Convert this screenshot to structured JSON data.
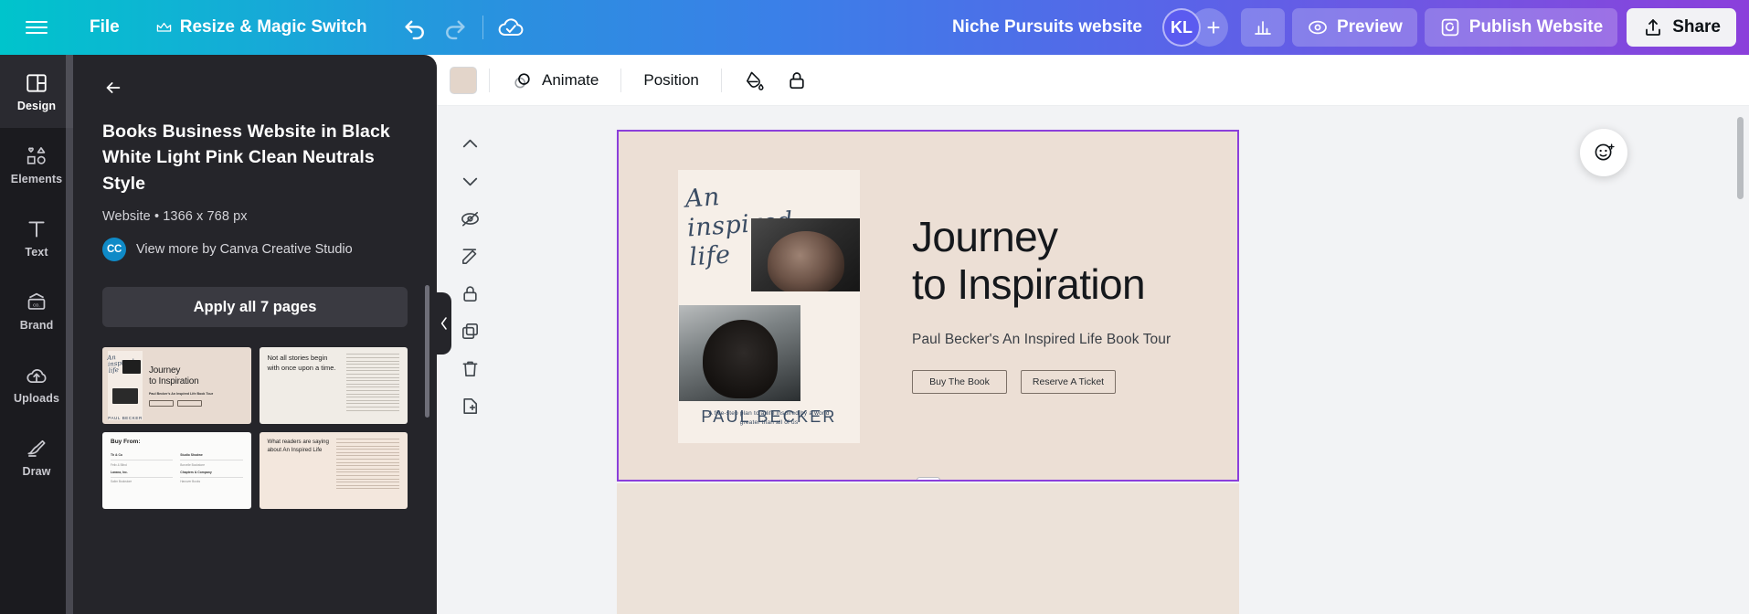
{
  "topbar": {
    "menu_label": "menu",
    "file": "File",
    "resize": "Resize & Magic Switch",
    "undo": "Undo",
    "redo": "Redo",
    "saved": "Saved to Cloud",
    "doc_title": "Niche Pursuits website",
    "avatar_initials": "KL",
    "invite_plus": "+",
    "analytics": "Analytics",
    "preview": "Preview",
    "publish": "Publish Website",
    "share": "Share",
    "gradient_start": "#00c4cc",
    "gradient_end": "#8b3fdb"
  },
  "rail": {
    "items": [
      {
        "label": "Design",
        "icon": "layout-icon",
        "active": true
      },
      {
        "label": "Elements",
        "icon": "shapes-icon",
        "active": false
      },
      {
        "label": "Text",
        "icon": "text-t-icon",
        "active": false
      },
      {
        "label": "Brand",
        "icon": "brand-card-icon",
        "active": false
      },
      {
        "label": "Uploads",
        "icon": "upload-cloud-icon",
        "active": false
      },
      {
        "label": "Draw",
        "icon": "pen-icon",
        "active": false
      }
    ]
  },
  "panel": {
    "back_label": "Back",
    "title": "Books Business Website in Black White Light Pink Clean Neutrals Style",
    "meta": "Website • 1366 x 768 px",
    "author_badge": "CC",
    "author_link": "View more by Canva Creative Studio",
    "apply_all": "Apply all 7 pages",
    "thumbnails": [
      {
        "name": "hero-page",
        "heading_line1": "Journey",
        "heading_line2": "to Inspiration",
        "subtitle": "Paul Becker's An Inspired Life Book Tour",
        "cover_script": "An inspired life",
        "cover_author": "PAUL BECKER"
      },
      {
        "name": "quote-page",
        "quote": "Not all stories begin with once upon a time."
      },
      {
        "name": "buy-from-page",
        "heading": "Buy From:",
        "stores": [
          {
            "name": "Th & Co",
            "detail": "Felix & Blind"
          },
          {
            "name": "Studio Shodwe",
            "detail": "Borcelle Bookstore"
          },
          {
            "name": "Larana, Inc.",
            "detail": "Salim Bookstore"
          },
          {
            "name": "Chapters & Company",
            "detail": "Hanover Books"
          }
        ]
      },
      {
        "name": "readers-page",
        "heading": "What readers are saying about An Inspired Life"
      }
    ]
  },
  "editor_toolbar": {
    "swatch_color": "#e3d5ca",
    "swatch_label": "Page color",
    "animate": "Animate",
    "position": "Position",
    "transparency": "Transparency",
    "lock": "Lock"
  },
  "vertical_tools": [
    {
      "name": "move-up-icon",
      "label": "Move up"
    },
    {
      "name": "move-down-icon",
      "label": "Move down"
    },
    {
      "name": "hide-page-icon",
      "label": "Hide page"
    },
    {
      "name": "notes-icon",
      "label": "Notes"
    },
    {
      "name": "lock-page-icon",
      "label": "Lock page"
    },
    {
      "name": "duplicate-page-icon",
      "label": "Duplicate page"
    },
    {
      "name": "delete-page-icon",
      "label": "Delete page"
    },
    {
      "name": "add-page-icon",
      "label": "Add page"
    }
  ],
  "canvas_page": {
    "background": "#ecdfd5",
    "selection_color": "#8b3fdb",
    "cover_script": "An inspired life",
    "cover_tagline": "A five-step plan to a life inspired by a world greater than all of us",
    "cover_author": "PAUL BECKER",
    "heading_line1": "Journey",
    "heading_line2": "to Inspiration",
    "subtitle": "Paul Becker's An Inspired Life Book Tour",
    "button_primary": "Buy The Book",
    "button_secondary": "Reserve A Ticket"
  },
  "ai_assistant": {
    "label": "Canva Assistant"
  }
}
